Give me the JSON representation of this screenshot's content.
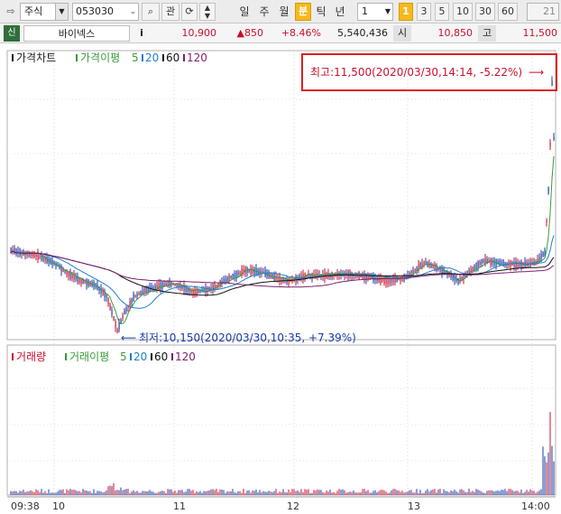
{
  "toolbar": {
    "market": "주식",
    "code": "053030",
    "btn_gwan": "관",
    "periods": [
      "일",
      "주",
      "월",
      "분",
      "틱",
      "년"
    ],
    "active_period": "분",
    "interval_value": "1",
    "intervals": [
      "1",
      "3",
      "5",
      "10",
      "30",
      "60"
    ],
    "active_interval": "1",
    "count_value": "21"
  },
  "quote": {
    "tag": "신",
    "name": "바이넥스",
    "info": "i",
    "price": "10,900",
    "change": "▲850",
    "change_pct": "+8.46%",
    "volume": "5,540,436",
    "open_label": "시",
    "open_value": "10,850",
    "high_label": "고",
    "high_value": "11,500"
  },
  "colors": {
    "up": "#c8102e",
    "down": "#1a3ca8",
    "ma5": "#3a9a3a",
    "ma20": "#1e7fd0",
    "ma60": "#111111",
    "ma120": "#7a1f6e",
    "highlight_box": "#e02020"
  },
  "chart_data": {
    "type": "candlestick",
    "price_panel": {
      "legend": {
        "title": "가격차트",
        "ma_label": "가격이평",
        "ma_periods": [
          "5",
          "20",
          "60",
          "120"
        ]
      },
      "high_annotation": "최고:11,500(2020/03/30,14:14, -5.22%)",
      "low_annotation": "최저:10,150(2020/03/30,10:35, +7.39%)",
      "price_range": [
        10150,
        11500
      ]
    },
    "volume_panel": {
      "legend": {
        "title": "거래량",
        "ma_label": "거래이평",
        "ma_periods": [
          "5",
          "20",
          "60",
          "120"
        ]
      }
    },
    "x_axis": {
      "ticks": [
        "09:38",
        "10",
        "11",
        "12",
        "13",
        "14:00"
      ]
    }
  }
}
